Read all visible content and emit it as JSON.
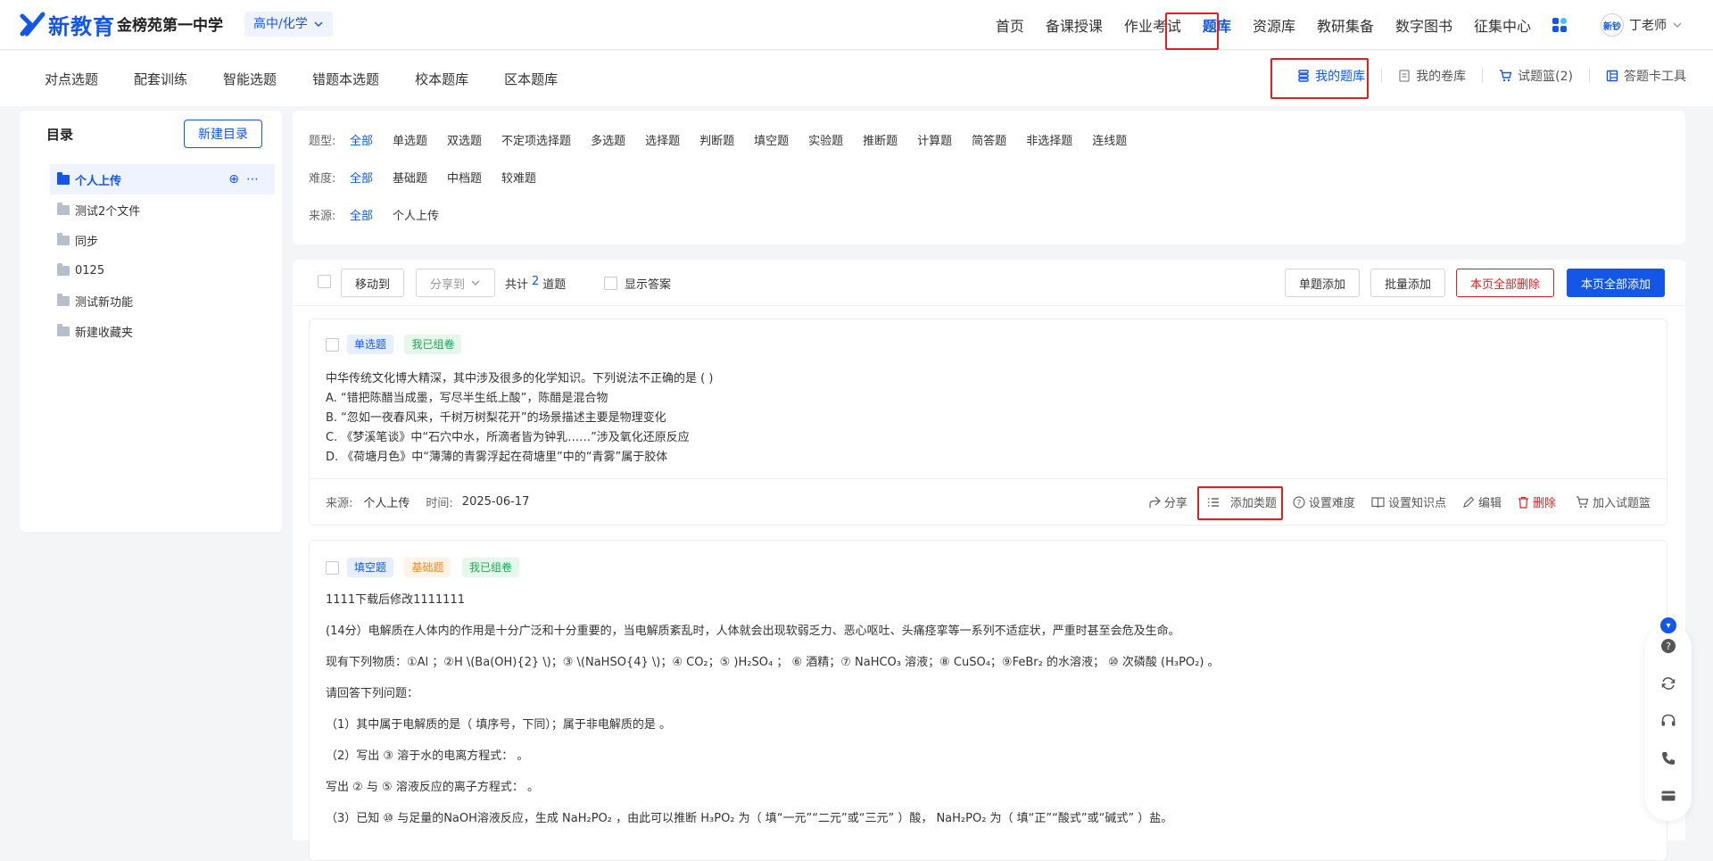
{
  "header": {
    "logo_text": "新教育",
    "school": "金榜苑第一中学",
    "subject": "高中/化学",
    "nav": [
      "首页",
      "备课授课",
      "作业考试",
      "题库",
      "资源库",
      "教研集备",
      "数字图书",
      "征集中心"
    ],
    "user": "丁老师",
    "avatar_text": "新钞"
  },
  "subnav": {
    "tabs": [
      "对点选题",
      "配套训练",
      "智能选题",
      "错题本选题",
      "校本题库",
      "区本题库"
    ],
    "tools": [
      "我的题库",
      "我的卷库",
      "试题篮(2)",
      "答题卡工具"
    ]
  },
  "sidebar": {
    "title": "目录",
    "new_button": "新建目录",
    "items": [
      "个人上传",
      "测试2个文件",
      "同步",
      "0125",
      "测试新功能",
      "新建收藏夹"
    ]
  },
  "filters": {
    "type_label": "题型:",
    "types": [
      "全部",
      "单选题",
      "双选题",
      "不定项选择题",
      "多选题",
      "选择题",
      "判断题",
      "填空题",
      "实验题",
      "推断题",
      "计算题",
      "简答题",
      "非选择题",
      "连线题"
    ],
    "difficulty_label": "难度:",
    "difficulties": [
      "全部",
      "基础题",
      "中档题",
      "较难题"
    ],
    "source_label": "来源:",
    "sources": [
      "全部",
      "个人上传"
    ]
  },
  "listbar": {
    "move_to": "移动到",
    "share_to": "分享到",
    "total_prefix": "共计",
    "total": "2",
    "total_suffix": "道题",
    "show_answer": "显示答案",
    "single_add": "单题添加",
    "batch_add": "批量添加",
    "delete_all": "本页全部删除",
    "add_all": "本页全部添加"
  },
  "q1": {
    "tags": [
      "单选题",
      "我已组卷"
    ],
    "stem": "中华传统文化博大精深，其中涉及很多的化学知识。下列说法不正确的是 ( )",
    "options": [
      "A. “错把陈醋当成墨，写尽半生纸上酸”，陈醋是混合物",
      "B. “忽如一夜春风来，千树万树梨花开”的场景描述主要是物理变化",
      "C. 《梦溪笔谈》中“石穴中水，所滴者皆为钟乳……”涉及氧化还原反应",
      "D. 《荷塘月色》中“薄薄的青雾浮起在荷塘里”中的“青雾”属于胶体"
    ],
    "source_label": "来源:",
    "source": "个人上传",
    "time_label": "时间:",
    "time": "2025-06-17",
    "actions": [
      "分享",
      "添加类题",
      "设置难度",
      "设置知识点",
      "编辑",
      "删除",
      "加入试题篮"
    ]
  },
  "q2": {
    "tags": [
      "填空题",
      "基础题",
      "我已组卷"
    ],
    "lines": [
      "1111下载后修改1111111",
      "(14分）电解质在人体内的作用是十分广泛和十分重要的，当电解质紊乱时，人体就会出现软弱乏力、恶心呕吐、头痛痉挛等一系列不适症状，严重时甚至会危及生命。",
      "现有下列物质：①Al ；②H \\(Ba(OH){2} \\)；③ \\(NaHSO{4} \\)；④ CO₂；⑤ )H₂SO₄ ； ⑥ 酒精；⑦ NaHCO₃ 溶液；⑧ CuSO₄；⑨FeBr₂ 的水溶液； ⑩ 次磷酸 (H₃PO₂) 。",
      "请回答下列问题：",
      "（1）其中属于电解质的是（ 填序号，下同）；属于非电解质的是 。",
      "（2）写出 ③ 溶于水的电离方程式： 。",
      "写出 ② 与 ⑤ 溶液反应的离子方程式： 。",
      "（3）已知 ⑩ 与足量的NaOH溶液反应，生成 NaH₂PO₂ ，由此可以推断 H₃PO₂ 为（ 填“一元”“二元”或“三元” ）酸， NaH₂PO₂ 为（ 填“正”“酸式”或“碱式” ）盐。"
    ]
  }
}
